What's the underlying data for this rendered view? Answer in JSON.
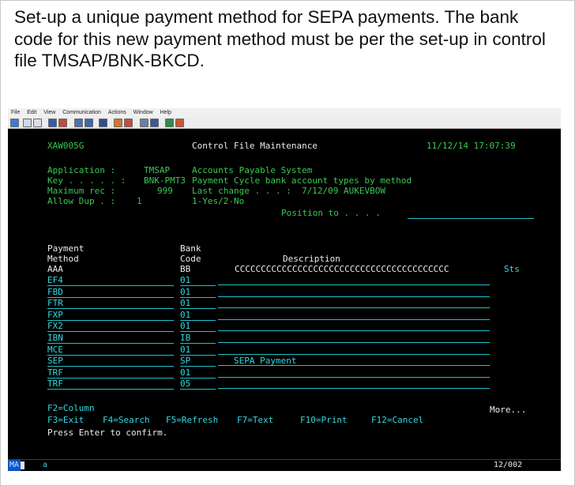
{
  "instruction": "Set-up a unique payment method for SEPA payments. The bank code for this new payment method must be per the set-up in control file TMSAP/BNK-BKCD.",
  "window_menu": [
    "File",
    "Edit",
    "View",
    "Communication",
    "Actions",
    "Window",
    "Help"
  ],
  "screen": {
    "program_id": "XAW005G",
    "title": "Control File Maintenance",
    "datetime": "11/12/14 17:07:39",
    "application_label": "Application :",
    "application_value": "TMSAP",
    "application_desc": "Accounts Payable System",
    "key_label": "Key . . . . . :",
    "key_value": "BNK-PMT3",
    "key_desc": "Payment Cycle bank account types by method",
    "maxrec_label": "Maximum rec :",
    "maxrec_value": "999",
    "last_change_label": "Last change . . . :",
    "last_change_value": "7/12/09 AUKEVBOW",
    "allowdup_label": "Allow Dup . :",
    "allowdup_value": "1",
    "allowdup_desc": "1-Yes/2-No",
    "position_to_label": "Position to . . . .",
    "position_to_value": ""
  },
  "table": {
    "col1_line1": "Payment",
    "col1_line2": "Method",
    "col2_line1": "Bank",
    "col2_line2": "Code",
    "col3_header": "Description",
    "pattern_method": "AAA",
    "pattern_code": "BB",
    "pattern_desc": "CCCCCCCCCCCCCCCCCCCCCCCCCCCCCCCCCCCCCCCCC",
    "sts_header": "Sts",
    "rows": [
      {
        "method": "EF4",
        "code": "01",
        "description": ""
      },
      {
        "method": "FBD",
        "code": "01",
        "description": ""
      },
      {
        "method": "FTR",
        "code": "01",
        "description": ""
      },
      {
        "method": "FXP",
        "code": "01",
        "description": ""
      },
      {
        "method": "FX2",
        "code": "01",
        "description": ""
      },
      {
        "method": "IBN",
        "code": "IB",
        "description": ""
      },
      {
        "method": "MCE",
        "code": "01",
        "description": ""
      },
      {
        "method": "SEP",
        "code": "SP",
        "description": "SEPA Payment"
      },
      {
        "method": "TRF",
        "code": "01",
        "description": ""
      },
      {
        "method": "TRF",
        "code": "05",
        "description": ""
      }
    ],
    "more": "More..."
  },
  "fkeys": {
    "f2": "F2=Column",
    "f3": "F3=Exit",
    "f4": "F4=Search",
    "f5": "F5=Refresh",
    "f7": "F7=Text",
    "f10": "F10=Print",
    "f12": "F12=Cancel"
  },
  "message": "Press Enter to confirm.",
  "statusbar": {
    "mode": "MA",
    "session": "a",
    "cursor_pos": "12/002"
  }
}
